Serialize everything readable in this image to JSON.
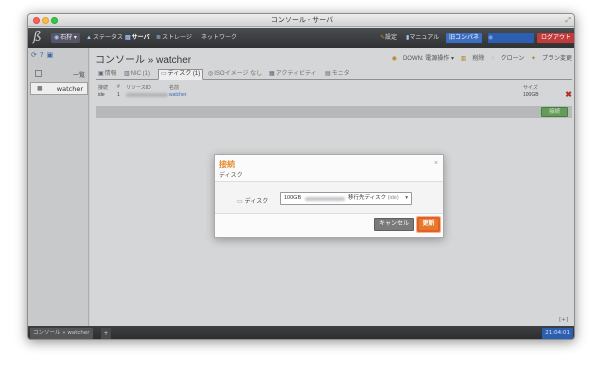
{
  "window": {
    "title": "コンソール - サーバ"
  },
  "topnav": {
    "zone": "石狩",
    "items": [
      "ステータス",
      "サーバ",
      "ストレージ",
      "ネットワーク"
    ],
    "right_items": [
      "設定",
      "マニュアル",
      "旧コンパネ",
      "ログアウト"
    ]
  },
  "sidebar": {
    "header_right": "一覧",
    "items": [
      {
        "label": "watcher"
      }
    ]
  },
  "main": {
    "breadcrumb": "コンソール » watcher",
    "actions": [
      "DOWN: 電源操作",
      "削除",
      "クローン",
      "プラン変更"
    ],
    "tabs": [
      "情報",
      "NIC (1)",
      "ディスク (1)",
      "ISOイメージ なし",
      "アクティビティ",
      "モニタ"
    ],
    "table": {
      "headers": [
        "接続",
        "#",
        "リソースID",
        "名前",
        "サイズ"
      ],
      "rows": [
        {
          "conn": "ide",
          "num": "1",
          "name": "watcher",
          "size": "100GB"
        }
      ]
    },
    "connect_button": "接続",
    "expand": "[+]"
  },
  "dialog": {
    "title": "接続",
    "subtitle": "ディスク",
    "field_label": "ディスク",
    "select_size": "100GB",
    "select_dest": "移行先ディスク",
    "select_tag": "(ide)",
    "cancel": "キャンセル",
    "update": "更新"
  },
  "statusbar": {
    "tab": "コンソール » watcher",
    "add": "+",
    "time": "21:04:01"
  },
  "colors": {
    "accent_orange": "#e67a2a",
    "link_blue": "#3b6fc2",
    "logout_red": "#c23a3a",
    "connect_green": "#69a65e"
  }
}
